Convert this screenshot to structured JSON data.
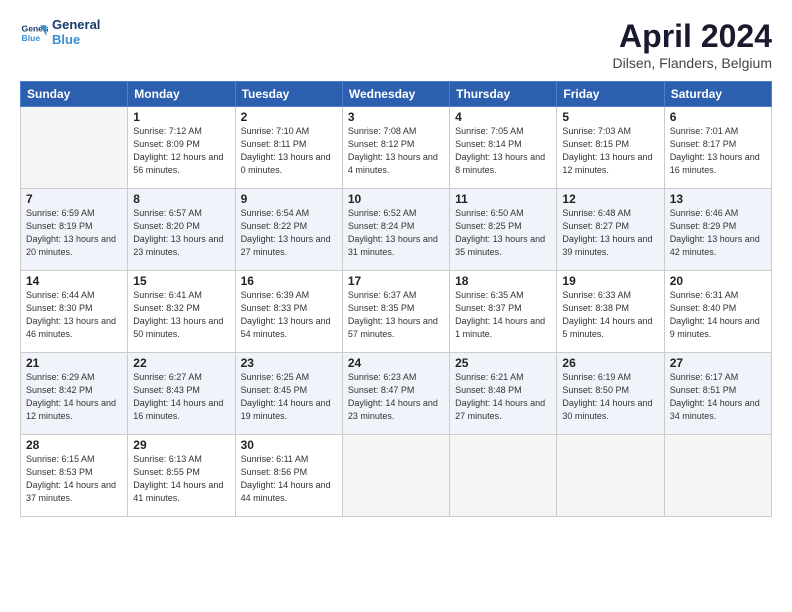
{
  "header": {
    "logo_line1": "General",
    "logo_line2": "Blue",
    "title": "April 2024",
    "location": "Dilsen, Flanders, Belgium"
  },
  "weekdays": [
    "Sunday",
    "Monday",
    "Tuesday",
    "Wednesday",
    "Thursday",
    "Friday",
    "Saturday"
  ],
  "weeks": [
    [
      {
        "day": "",
        "empty": true
      },
      {
        "day": "1",
        "sunrise": "7:12 AM",
        "sunset": "8:09 PM",
        "daylight": "12 hours and 56 minutes."
      },
      {
        "day": "2",
        "sunrise": "7:10 AM",
        "sunset": "8:11 PM",
        "daylight": "13 hours and 0 minutes."
      },
      {
        "day": "3",
        "sunrise": "7:08 AM",
        "sunset": "8:12 PM",
        "daylight": "13 hours and 4 minutes."
      },
      {
        "day": "4",
        "sunrise": "7:05 AM",
        "sunset": "8:14 PM",
        "daylight": "13 hours and 8 minutes."
      },
      {
        "day": "5",
        "sunrise": "7:03 AM",
        "sunset": "8:15 PM",
        "daylight": "13 hours and 12 minutes."
      },
      {
        "day": "6",
        "sunrise": "7:01 AM",
        "sunset": "8:17 PM",
        "daylight": "13 hours and 16 minutes."
      }
    ],
    [
      {
        "day": "7",
        "sunrise": "6:59 AM",
        "sunset": "8:19 PM",
        "daylight": "13 hours and 20 minutes."
      },
      {
        "day": "8",
        "sunrise": "6:57 AM",
        "sunset": "8:20 PM",
        "daylight": "13 hours and 23 minutes."
      },
      {
        "day": "9",
        "sunrise": "6:54 AM",
        "sunset": "8:22 PM",
        "daylight": "13 hours and 27 minutes."
      },
      {
        "day": "10",
        "sunrise": "6:52 AM",
        "sunset": "8:24 PM",
        "daylight": "13 hours and 31 minutes."
      },
      {
        "day": "11",
        "sunrise": "6:50 AM",
        "sunset": "8:25 PM",
        "daylight": "13 hours and 35 minutes."
      },
      {
        "day": "12",
        "sunrise": "6:48 AM",
        "sunset": "8:27 PM",
        "daylight": "13 hours and 39 minutes."
      },
      {
        "day": "13",
        "sunrise": "6:46 AM",
        "sunset": "8:29 PM",
        "daylight": "13 hours and 42 minutes."
      }
    ],
    [
      {
        "day": "14",
        "sunrise": "6:44 AM",
        "sunset": "8:30 PM",
        "daylight": "13 hours and 46 minutes."
      },
      {
        "day": "15",
        "sunrise": "6:41 AM",
        "sunset": "8:32 PM",
        "daylight": "13 hours and 50 minutes."
      },
      {
        "day": "16",
        "sunrise": "6:39 AM",
        "sunset": "8:33 PM",
        "daylight": "13 hours and 54 minutes."
      },
      {
        "day": "17",
        "sunrise": "6:37 AM",
        "sunset": "8:35 PM",
        "daylight": "13 hours and 57 minutes."
      },
      {
        "day": "18",
        "sunrise": "6:35 AM",
        "sunset": "8:37 PM",
        "daylight": "14 hours and 1 minute."
      },
      {
        "day": "19",
        "sunrise": "6:33 AM",
        "sunset": "8:38 PM",
        "daylight": "14 hours and 5 minutes."
      },
      {
        "day": "20",
        "sunrise": "6:31 AM",
        "sunset": "8:40 PM",
        "daylight": "14 hours and 9 minutes."
      }
    ],
    [
      {
        "day": "21",
        "sunrise": "6:29 AM",
        "sunset": "8:42 PM",
        "daylight": "14 hours and 12 minutes."
      },
      {
        "day": "22",
        "sunrise": "6:27 AM",
        "sunset": "8:43 PM",
        "daylight": "14 hours and 16 minutes."
      },
      {
        "day": "23",
        "sunrise": "6:25 AM",
        "sunset": "8:45 PM",
        "daylight": "14 hours and 19 minutes."
      },
      {
        "day": "24",
        "sunrise": "6:23 AM",
        "sunset": "8:47 PM",
        "daylight": "14 hours and 23 minutes."
      },
      {
        "day": "25",
        "sunrise": "6:21 AM",
        "sunset": "8:48 PM",
        "daylight": "14 hours and 27 minutes."
      },
      {
        "day": "26",
        "sunrise": "6:19 AM",
        "sunset": "8:50 PM",
        "daylight": "14 hours and 30 minutes."
      },
      {
        "day": "27",
        "sunrise": "6:17 AM",
        "sunset": "8:51 PM",
        "daylight": "14 hours and 34 minutes."
      }
    ],
    [
      {
        "day": "28",
        "sunrise": "6:15 AM",
        "sunset": "8:53 PM",
        "daylight": "14 hours and 37 minutes."
      },
      {
        "day": "29",
        "sunrise": "6:13 AM",
        "sunset": "8:55 PM",
        "daylight": "14 hours and 41 minutes."
      },
      {
        "day": "30",
        "sunrise": "6:11 AM",
        "sunset": "8:56 PM",
        "daylight": "14 hours and 44 minutes."
      },
      {
        "day": "",
        "empty": true
      },
      {
        "day": "",
        "empty": true
      },
      {
        "day": "",
        "empty": true
      },
      {
        "day": "",
        "empty": true
      }
    ]
  ],
  "labels": {
    "sunrise": "Sunrise:",
    "sunset": "Sunset:",
    "daylight": "Daylight:"
  }
}
